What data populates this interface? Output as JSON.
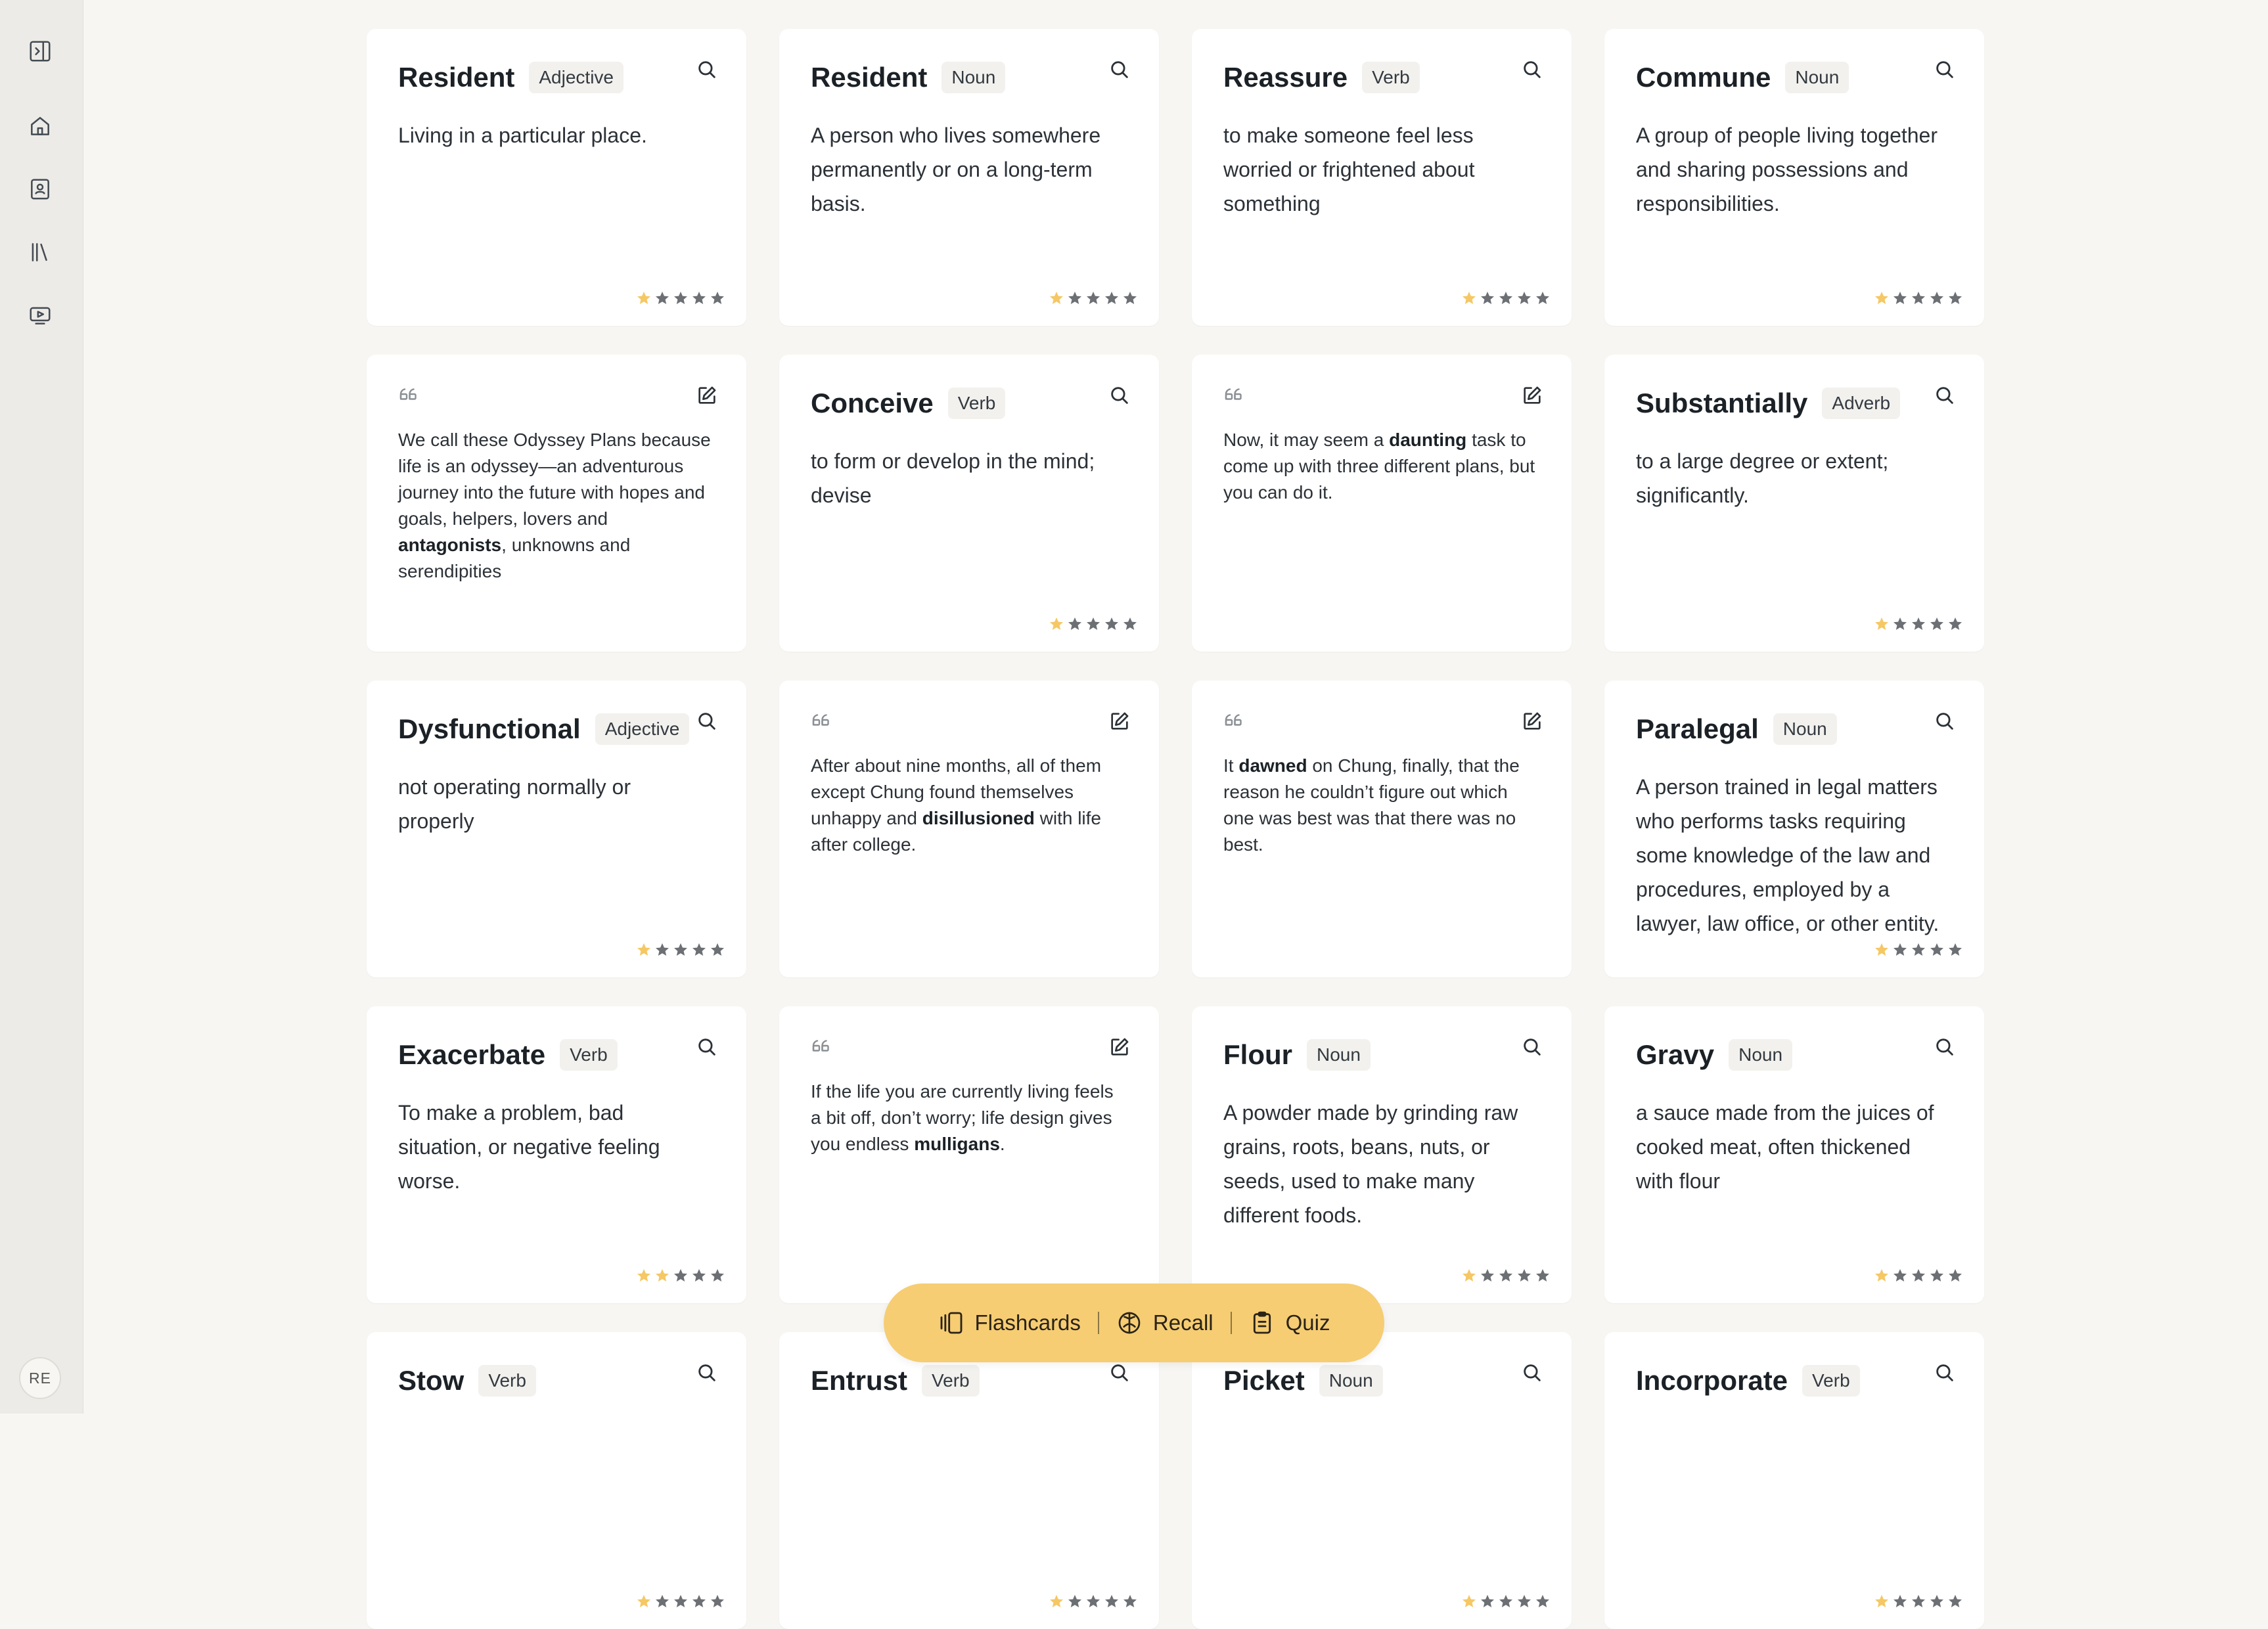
{
  "sidebar": {
    "items": [
      {
        "name": "sidebar-toggle-icon"
      },
      {
        "name": "home-icon"
      },
      {
        "name": "contacts-book-icon"
      },
      {
        "name": "library-icon"
      },
      {
        "name": "video-icon"
      }
    ],
    "avatar_initials": "RE"
  },
  "colors": {
    "star_filled": "#f5c865",
    "star_empty": "#6c6f73",
    "tab_bar": "#f6cd73"
  },
  "cards": [
    {
      "type": "word",
      "word": "Resident",
      "pos": "Adjective",
      "definition": "Living in a particular place.",
      "rating": 1
    },
    {
      "type": "word",
      "word": "Resident",
      "pos": "Noun",
      "definition": "A person who lives somewhere permanently or on a long-term basis.",
      "rating": 1
    },
    {
      "type": "word",
      "word": "Reassure",
      "pos": "Verb",
      "definition": "to make someone feel less worried or frightened about something",
      "rating": 1
    },
    {
      "type": "word",
      "word": "Commune",
      "pos": "Noun",
      "definition": "A group of people living together and sharing possessions and responsibilities.",
      "rating": 1
    },
    {
      "type": "quote",
      "segments": [
        {
          "text": "We call these Odyssey Plans because life is an odyssey—an adventurous journey into the future with hopes and goals, helpers, lovers and "
        },
        {
          "text": "antagonists",
          "bold": true
        },
        {
          "text": ", unknowns and serendipities"
        }
      ]
    },
    {
      "type": "word",
      "word": "Conceive",
      "pos": "Verb",
      "definition": "to form or develop in the mind; devise",
      "rating": 1
    },
    {
      "type": "quote",
      "segments": [
        {
          "text": "Now, it may seem a "
        },
        {
          "text": "daunting",
          "bold": true
        },
        {
          "text": " task to come up with three different plans, but you can do it."
        }
      ]
    },
    {
      "type": "word",
      "word": "Substantially",
      "pos": "Adverb",
      "definition": "to a large degree or extent; significantly.",
      "rating": 1
    },
    {
      "type": "word",
      "word": "Dysfunctional",
      "pos": "Adjective",
      "definition": "not operating normally or properly",
      "rating": 1
    },
    {
      "type": "quote",
      "segments": [
        {
          "text": "After about nine months, all of them except Chung found themselves unhappy and "
        },
        {
          "text": "disillusioned",
          "bold": true
        },
        {
          "text": " with life after college."
        }
      ]
    },
    {
      "type": "quote",
      "segments": [
        {
          "text": "It "
        },
        {
          "text": "dawned",
          "bold": true
        },
        {
          "text": " on Chung, finally, that the reason he couldn’t figure out which one was best was that there was no best."
        }
      ]
    },
    {
      "type": "word",
      "word": "Paralegal",
      "pos": "Noun",
      "definition": "A person trained in legal matters who performs tasks requiring some knowledge of the law and procedures, employed by a lawyer, law office, or other entity.",
      "rating": 1
    },
    {
      "type": "word",
      "word": "Exacerbate",
      "pos": "Verb",
      "definition": "To make a problem, bad situation, or negative feeling worse.",
      "rating": 2
    },
    {
      "type": "quote",
      "segments": [
        {
          "text": "If the life you are currently living feels a bit off, don’t worry; life design gives you endless "
        },
        {
          "text": "mulligans",
          "bold": true
        },
        {
          "text": "."
        }
      ]
    },
    {
      "type": "word",
      "word": "Flour",
      "pos": "Noun",
      "definition": "A powder made by grinding raw grains, roots, beans, nuts, or seeds, used to make many different foods.",
      "rating": 1
    },
    {
      "type": "word",
      "word": "Gravy",
      "pos": "Noun",
      "definition": "a sauce made from the juices of cooked meat, often thickened with flour",
      "rating": 1
    },
    {
      "type": "word",
      "word": "Stow",
      "pos": "Verb",
      "definition": "",
      "rating": 1
    },
    {
      "type": "word",
      "word": "Entrust",
      "pos": "Verb",
      "definition": "",
      "rating": 1
    },
    {
      "type": "word",
      "word": "Picket",
      "pos": "Noun",
      "definition": "",
      "rating": 1
    },
    {
      "type": "word",
      "word": "Incorporate",
      "pos": "Verb",
      "definition": "",
      "rating": 1
    }
  ],
  "rating_max": 5,
  "tabs": [
    {
      "label": "Flashcards",
      "icon": "flashcards-icon"
    },
    {
      "label": "Recall",
      "icon": "brain-icon"
    },
    {
      "label": "Quiz",
      "icon": "clipboard-icon"
    }
  ]
}
